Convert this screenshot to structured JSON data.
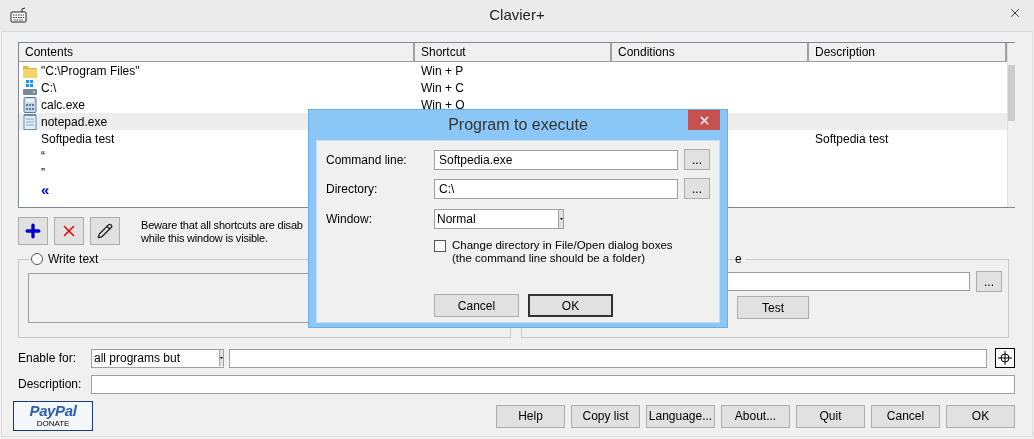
{
  "window": {
    "title": "Clavier+"
  },
  "list": {
    "columns": [
      "Contents",
      "Shortcut",
      "Conditions",
      "Description"
    ],
    "rows": [
      {
        "kind": "folder",
        "contents": "\"C:\\Program Files\"",
        "shortcut": "Win + P",
        "selected": false
      },
      {
        "kind": "drive",
        "contents": "C:\\",
        "shortcut": "Win + C",
        "selected": false
      },
      {
        "kind": "calculator",
        "contents": "calc.exe",
        "shortcut": "Win + O",
        "selected": false
      },
      {
        "kind": "notepad",
        "contents": "notepad.exe",
        "selected": true
      },
      {
        "kind": "plain",
        "contents": "Softpedia test",
        "description": "Softpedia test",
        "selected": false
      },
      {
        "kind": "plain",
        "contents": "“",
        "selected": false
      },
      {
        "kind": "plain",
        "contents": "”",
        "selected": false
      },
      {
        "kind": "plain",
        "contents": "«",
        "selected": false,
        "color": "#0000ff"
      }
    ]
  },
  "notice": [
    "Beware that all shortcuts are disab",
    "while this window is visible."
  ],
  "write_text": {
    "label": "Write text",
    "selected": false
  },
  "program_group": {
    "label": "e",
    "browse": "...",
    "test": "Test"
  },
  "enable_for": {
    "label": "Enable for:",
    "value": "all programs but"
  },
  "description": {
    "label": "Description:"
  },
  "donate": {
    "brand": "PayPal",
    "label": "DONATE"
  },
  "buttons": [
    "Help",
    "Copy list",
    "Language...",
    "About...",
    "Quit",
    "Cancel",
    "OK"
  ],
  "dialog": {
    "title": "Program to execute",
    "fields": [
      {
        "label": "Command line:",
        "value": "Softpedia.exe",
        "browse": "..."
      },
      {
        "label": "Directory:",
        "value": "C:\\",
        "browse": "..."
      }
    ],
    "window_mode": {
      "label": "Window:",
      "value": "Normal"
    },
    "option": {
      "lines": [
        "Change directory in File/Open dialog boxes",
        "(the command line should be a folder)"
      ],
      "checked": false
    },
    "buttons": [
      {
        "label": "Cancel",
        "default": false
      },
      {
        "label": "OK",
        "default": true
      }
    ]
  }
}
